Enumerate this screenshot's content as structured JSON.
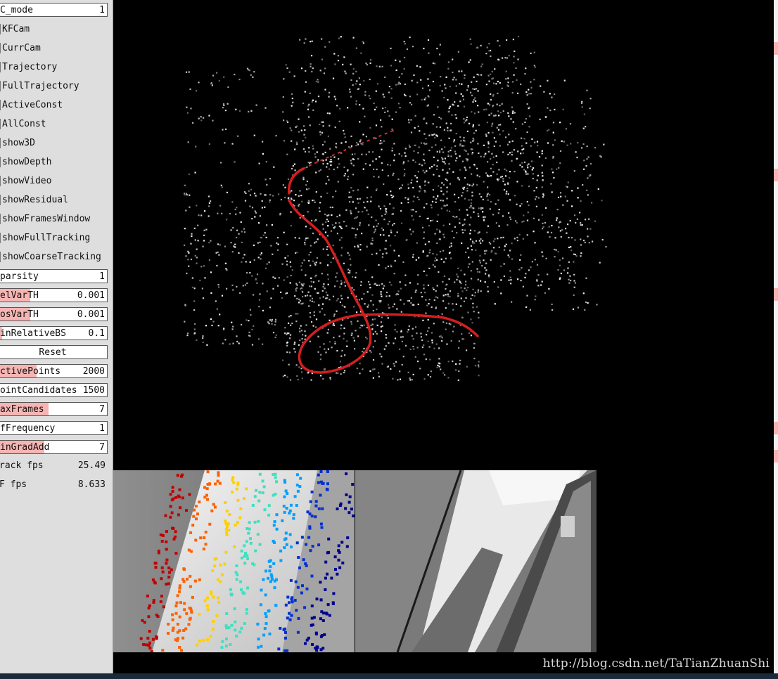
{
  "panel": {
    "rows": [
      {
        "label": "C_mode",
        "value": "1"
      },
      {
        "label": "KFCam"
      },
      {
        "label": "CurrCam"
      },
      {
        "label": "Trajectory"
      },
      {
        "label": "FullTrajectory"
      },
      {
        "label": "ActiveConst"
      },
      {
        "label": "AllConst"
      },
      {
        "label": "show3D"
      },
      {
        "label": "showDepth"
      },
      {
        "label": "showVideo"
      },
      {
        "label": "showResidual"
      },
      {
        "label": "showFramesWindow"
      },
      {
        "label": "showFullTracking"
      },
      {
        "label": "showCoarseTracking"
      },
      {
        "label": "parsity",
        "value": "1"
      },
      {
        "label": "elVarTH",
        "value": "0.001"
      },
      {
        "label": "osVarTH",
        "value": "0.001"
      },
      {
        "label": "inRelativeBS",
        "value": "0.1"
      },
      {
        "label": "Reset"
      },
      {
        "label": "ctivePoints",
        "value": "2000"
      },
      {
        "label": "ointCandidates",
        "value": "1500"
      },
      {
        "label": "axFrames",
        "value": "7"
      },
      {
        "label": "fFrequency",
        "value": "1"
      },
      {
        "label": "inGradAdd",
        "value": "7"
      },
      {
        "label": "rack fps",
        "value": "25.49"
      },
      {
        "label": "F fps",
        "value": "8.633"
      }
    ],
    "slider_levels": {
      "elVarTH": 0.29,
      "osVarTH": 0.29,
      "inRelativeBS": 0.03,
      "ctivePoints": 0.35,
      "axFrames": 0.46,
      "fFrequency": 0.0,
      "inGradAdd": 0.42
    }
  },
  "watermark": "http://blog.csdn.net/TaTianZhuanShi",
  "colors": {
    "panel_bg": "#dedede",
    "slider_fill": "#f6b5b3",
    "trajectory": "#d41e1e",
    "background": "#000000"
  }
}
